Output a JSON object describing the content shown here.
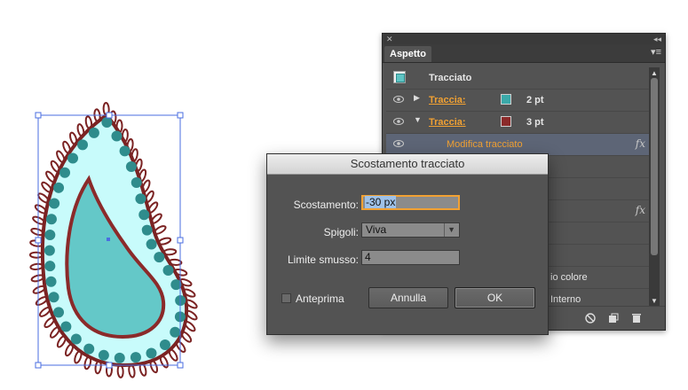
{
  "panel": {
    "close_glyph": "✕",
    "collapse_glyph": "◂◂",
    "tab_label": "Aspetto",
    "menu_glyph": "▾≡",
    "rows": [
      {
        "type": "header",
        "label": "Tracciato"
      },
      {
        "type": "stroke",
        "label": "Traccia:",
        "swatch_color": "#3ba9a9",
        "weight": "2 pt",
        "expanded": false
      },
      {
        "type": "stroke",
        "label": "Traccia:",
        "swatch_color": "#8b2a2a",
        "weight": "3 pt",
        "expanded": true
      },
      {
        "type": "effect",
        "label": "Modifica tracciato",
        "fx": "fx",
        "selected": true
      },
      {
        "type": "plain",
        "label": ""
      },
      {
        "type": "plain",
        "label": ""
      },
      {
        "type": "fx",
        "label": "",
        "fx": "fx"
      },
      {
        "type": "plain",
        "label": ""
      },
      {
        "type": "plain",
        "label": ""
      },
      {
        "type": "text",
        "label": "io colore"
      },
      {
        "type": "text",
        "label": "Interno"
      }
    ],
    "footer_icons": [
      "clear-appearance-icon",
      "duplicate-item-icon",
      "delete-item-icon"
    ]
  },
  "dialog": {
    "title": "Scostamento tracciato",
    "offset_label": "Scostamento:",
    "offset_value": "-30 px",
    "joins_label": "Spigoli:",
    "joins_value": "Viva",
    "miter_label": "Limite smusso:",
    "miter_value": "4",
    "preview_label": "Anteprima",
    "preview_checked": false,
    "cancel_label": "Annulla",
    "ok_label": "OK"
  },
  "colors": {
    "fill": "#64c8c8",
    "inner_stroke": "#8b2a2a",
    "light_band": "#c8fbfb",
    "dark_band": "#2f8c8c",
    "outline": "#7b2323",
    "selection": "#4a6ee0",
    "accent": "#f1a133"
  }
}
